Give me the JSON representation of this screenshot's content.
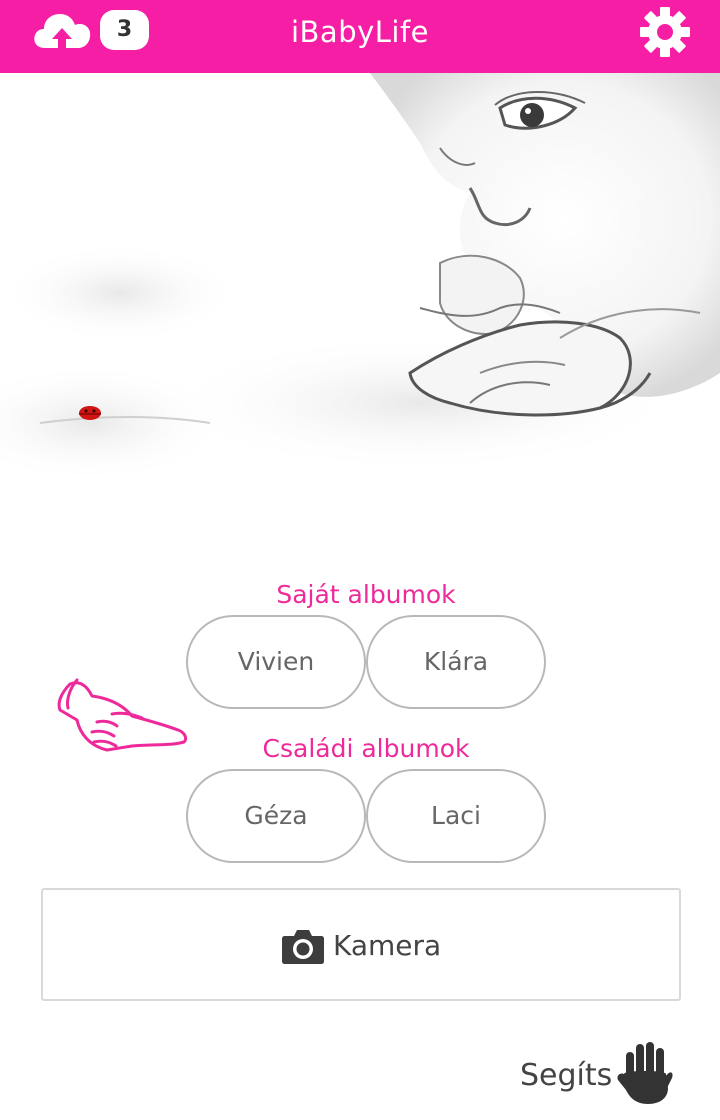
{
  "header": {
    "title": "iBabyLife",
    "upload_icon": "cloud-upload-icon",
    "badge_count": "3",
    "settings_icon": "gear-icon",
    "background_color": "#f61ea4"
  },
  "hero": {
    "image": "sketch of baby with ladybug"
  },
  "own_albums": {
    "title": "Saját albumok",
    "items": [
      {
        "label": "Vivien"
      },
      {
        "label": "Klára"
      }
    ]
  },
  "family_albums": {
    "title": "Családi albumok",
    "items": [
      {
        "label": "Géza"
      },
      {
        "label": "Laci"
      }
    ]
  },
  "pointer_icon": "pointing-hand-icon",
  "camera": {
    "icon": "camera-icon",
    "label": "Kamera"
  },
  "help": {
    "label": "Segíts",
    "icon": "waving-hand-icon"
  },
  "accent_color": "#ee2a9a"
}
